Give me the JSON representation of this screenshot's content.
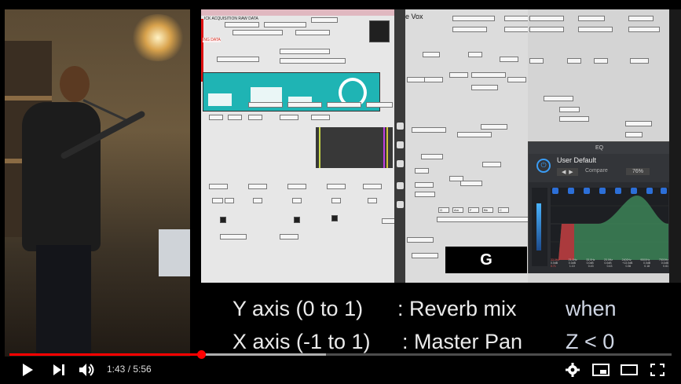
{
  "video": {
    "caption_lines": [
      {
        "left": "Y axis (0 to 1)",
        "right": ": Reverb mix",
        "cond": "when"
      },
      {
        "left": "X axis (-1 to 1)",
        "right": ": Master Pan",
        "cond": "Z < 0"
      }
    ],
    "screen_left_title": "ICK ACQUISITION RAW DATA",
    "screen_left_subtitle": "ING DATA",
    "screen_right_title": "e Vox",
    "g_key": "G",
    "note_keys": [
      "G",
      "Am",
      "F",
      "Bb",
      "C"
    ]
  },
  "eq_plugin": {
    "preset": "User Default",
    "compare": "Compare",
    "zoom": "76%",
    "section_label": "EQ",
    "freq_row": [
      "33.0Hz",
      "21.0Hz",
      "33.0Hz",
      "23.0Hz",
      "2400Hz",
      "9500Hz",
      "7500Hz"
    ],
    "gain_row": [
      "0.0dB",
      "0.0dB",
      "0.0dB",
      "0.0dB",
      "+13.0dB",
      "0.0dB",
      "0.0dB"
    ],
    "q_row": [
      "0.71",
      "1.10",
      "0.43",
      "0.43",
      "0.36",
      "0.18",
      "0.61"
    ]
  },
  "player": {
    "current_time": "1:43",
    "duration": "5:56",
    "progress_fraction": 0.289,
    "buffered_fraction": 0.478,
    "accent": "#ff0000"
  },
  "icons": [
    "play-icon",
    "next-icon",
    "volume-icon",
    "settings-gear-icon",
    "miniplayer-icon",
    "theater-icon",
    "fullscreen-icon"
  ]
}
